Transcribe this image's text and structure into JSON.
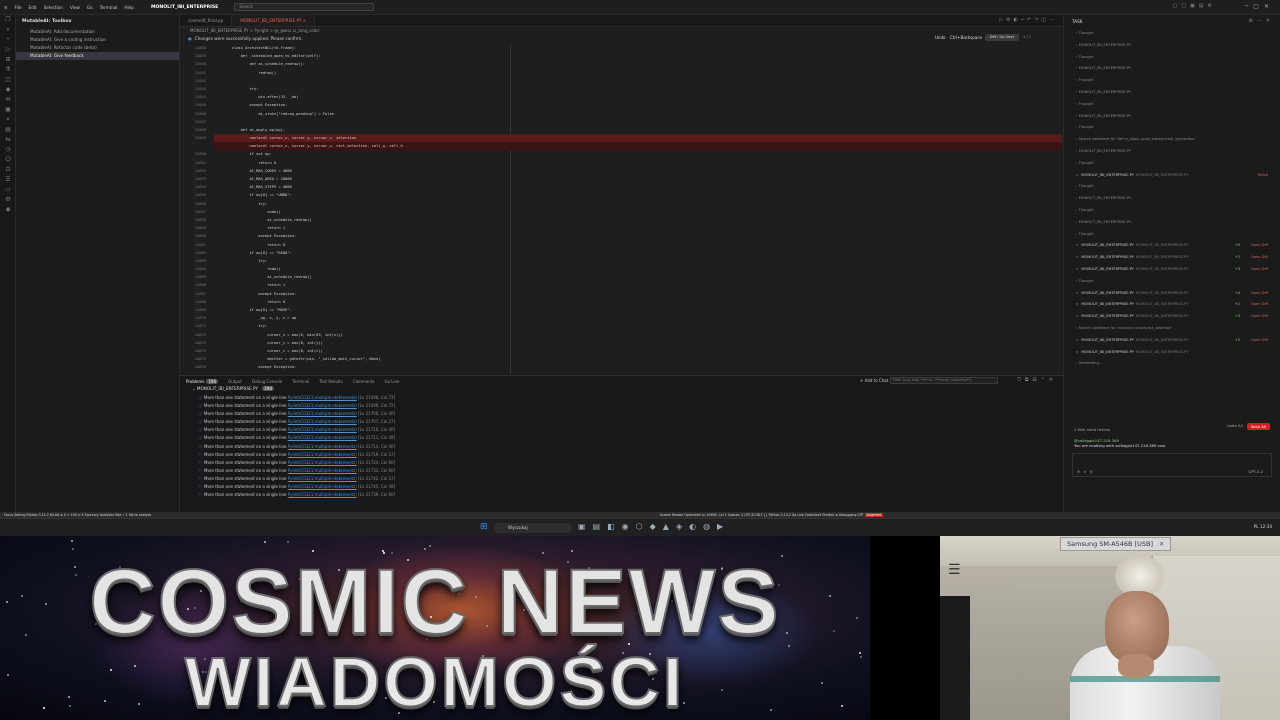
{
  "titlebar": {
    "menus": [
      "File",
      "Edit",
      "Selection",
      "View",
      "Go",
      "Terminal",
      "Help"
    ],
    "title": "MONOLIT_IBI_ENTERPRISE",
    "search_placeholder": "Search"
  },
  "sidebar": {
    "heading": "MutableAI: Toolbox",
    "items": [
      {
        "label": "MutableAI: Add documentation"
      },
      {
        "label": "MutableAI: Give a coding instruction"
      },
      {
        "label": "MutableAI: Refactor code (beta)"
      },
      {
        "label": "MutableAI: Give feedback"
      }
    ]
  },
  "editor": {
    "tabs": [
      {
        "label": "cosmolit_final.py"
      },
      {
        "label": "MONOLIT_IBI_ENTERPRISE.PY ×"
      }
    ],
    "breadcrumb": "MONOLIT_IBI_ENTERPRISE.PY > Pyright > @_gwiss ui_lang_code:",
    "notice": "Changes were successfully applied. Please confirm.",
    "undo_label": "Undo",
    "kb_label": "Ctrl+Backspace",
    "pill_label": "Diff / Go Over",
    "pill2_label": "1 / 1",
    "gutter": [
      "14638",
      "14639",
      "14640",
      "14641",
      "14642",
      "14643",
      "14644",
      "14645",
      "14646",
      "14647",
      "14648",
      "14649",
      "",
      "14650",
      "14651",
      "14652",
      "14653",
      "14654",
      "14655",
      "14656",
      "14657",
      "14658",
      "14659",
      "14660",
      "14661",
      "14662",
      "14663",
      "14664",
      "14665",
      "14666",
      "14667",
      "14668",
      "14669",
      "14670",
      "14671",
      "14672",
      "14673",
      "14674",
      "14675",
      "14676",
      "14677",
      "14678"
    ],
    "code": [
      "        class ArchitectBLL(tk.Frame):",
      "            def _scheduled_open_to_editor(self):",
      "                def ai_schedule_redraw():",
      "                    redraw()",
      "",
      "                try:",
      "                    win.after(33, _do)",
      "                except Exception:",
      "                    ai_state[\"redraw_pending\"] = False",
      "",
      "            def ai_apply_op(op):",
      "                nonlocal cursor_x, cursor_y, cursor_c, selection",
      "                nonlocal cursor_x, cursor_y, cursor_c, rect_selection, cell_w, cell_h",
      "                if not op:",
      "                    return 0",
      "                AI_MAX_CODES = 4000",
      "                AI_MAX_AREA = 20000",
      "                AI_MAX_STEPS = 4000",
      "                if op[0] == \"UNDO\":",
      "                    try:",
      "                        undo()",
      "                        ai_schedule_redraw()",
      "                        return 1",
      "                    except Exception:",
      "                        return 0",
      "                if op[0] == \"REDO\":",
      "                    try:",
      "                        redo()",
      "                        ai_schedule_redraw()",
      "                        return 1",
      "                    except Exception:",
      "                        return 0",
      "                if op[0] == \"MOVE\":",
      "                    _op, x, y, c = op",
      "                    try:",
      "                        cursor_x = max(0, min(63, int(x)))",
      "                        cursor_y = max(0, int(y))",
      "                        cursor_c = max(0, int(c))",
      "                        emitter = getattr(win, \"_collab_emit_cursor\", None)",
      "                    except Exception:",
      "                        pass",
      "                    if emitter:"
    ]
  },
  "panel": {
    "tabs": [
      {
        "label": "Problems",
        "badge": "194"
      },
      {
        "label": "Output"
      },
      {
        "label": "Debug Console"
      },
      {
        "label": "Terminal"
      },
      {
        "label": "Test Results"
      },
      {
        "label": "Comments"
      },
      {
        "label": "Go Live"
      }
    ],
    "add_chat": "+ Add to Chat",
    "filter_placeholder": "Filter (e.g. text, **/*.ts, !**/node_modules/**)",
    "file_label": "MONOLIT_IBI_ENTERPRISE.PY",
    "file_badge": "194",
    "problems": [
      {
        "msg": "More than one statement on a single line",
        "src": "Pylint(C0321:multiple-statements)",
        "loc": "[Ln 21098, Col 73]"
      },
      {
        "msg": "More than one statement on a single line",
        "src": "Pylint(C0321:multiple-statements)",
        "loc": "[Ln 21099, Col 72]"
      },
      {
        "msg": "More than one statement on a single line",
        "src": "Pylint(C0321:multiple-statements)",
        "loc": "[Ln 21700, Col 40]"
      },
      {
        "msg": "More than one statement on a single line",
        "src": "Pylint(C0321:multiple-statements)",
        "loc": "[Ln 21707, Col 27]"
      },
      {
        "msg": "More than one statement on a single line",
        "src": "Pylint(C0321:multiple-statements)",
        "loc": "[Ln 21710, Col 40]"
      },
      {
        "msg": "More than one statement on a single line",
        "src": "Pylint(C0321:multiple-statements)",
        "loc": "[Ln 21711, Col 49]"
      },
      {
        "msg": "More than one statement on a single line",
        "src": "Pylint(C0321:multiple-statements)",
        "loc": "[Ln 21714, Col 40]"
      },
      {
        "msg": "More than one statement on a single line",
        "src": "Pylint(C0321:multiple-statements)",
        "loc": "[Ln 21719, Col 37]"
      },
      {
        "msg": "More than one statement on a single line",
        "src": "Pylint(C0321:multiple-statements)",
        "loc": "[Ln 21724, Col 60]"
      },
      {
        "msg": "More than one statement on a single line",
        "src": "Pylint(C0321:multiple-statements)",
        "loc": "[Ln 21733, Col 60]"
      },
      {
        "msg": "More than one statement on a single line",
        "src": "Pylint(C0321:multiple-statements)",
        "loc": "[Ln 21742, Col 37]"
      },
      {
        "msg": "More than one statement on a single line",
        "src": "Pylint(C0321:multiple-statements)",
        "loc": "[Ln 21745, Col 49]"
      },
      {
        "msg": "More than one statement on a single line",
        "src": "Pylint(C0321:multiple-statements)",
        "loc": "[Ln 21739, Col 60]"
      }
    ]
  },
  "chat": {
    "heading": "TASK",
    "rows": [
      {
        "type": "text",
        "label": "Thought"
      },
      {
        "type": "text",
        "label": "MONOLIT_IBI_ENTERPRISE.PY"
      },
      {
        "type": "text",
        "label": "Thought"
      },
      {
        "type": "text",
        "label": "MONOLIT_IBI_ENTERPRISE.PY"
      },
      {
        "type": "text",
        "label": "Thought"
      },
      {
        "type": "text",
        "label": "MONOLIT_IBI_ENTERPRISE.PY"
      },
      {
        "type": "text",
        "label": "Thought"
      },
      {
        "type": "text",
        "label": "MONOLIT_IBI_ENTERPRISE.PY"
      },
      {
        "type": "text",
        "label": "Thought"
      },
      {
        "type": "text",
        "label": "Search codebase for 'def ai_apply_op|ai_state|cursor_x|selection'"
      },
      {
        "type": "text",
        "label": "MONOLIT_IBI_ENTERPRISE.PY"
      },
      {
        "type": "text",
        "label": "Thought"
      },
      {
        "type": "file",
        "label": "MONOLIT_IBI_ENTERPRISE.PY",
        "path": "MONOLIT_IBI_ENTERPRISE.PY",
        "plus": "",
        "status": "Failed"
      },
      {
        "type": "text",
        "label": "Thought"
      },
      {
        "type": "text",
        "label": "MONOLIT_IBI_ENTERPRISE.PY"
      },
      {
        "type": "text",
        "label": "Thought"
      },
      {
        "type": "text",
        "label": "MONOLIT_IBI_ENTERPRISE.PY"
      },
      {
        "type": "text",
        "label": "Thought"
      },
      {
        "type": "file",
        "label": "MONOLIT_IBI_ENTERPRISE.PY",
        "path": "MONOLIT_IBI_ENTERPRISE.PY",
        "plus": "+5",
        "status": "Open Diff"
      },
      {
        "type": "file",
        "label": "MONOLIT_IBI_ENTERPRISE.PY",
        "path": "MONOLIT_IBI_ENTERPRISE.PY",
        "plus": "+2",
        "status": "Open Diff"
      },
      {
        "type": "file",
        "label": "MONOLIT_IBI_ENTERPRISE.PY",
        "path": "MONOLIT_IBI_ENTERPRISE.PY",
        "plus": "+3",
        "status": "Open Diff"
      },
      {
        "type": "text",
        "label": "Thought"
      },
      {
        "type": "file",
        "label": "MONOLIT_IBI_ENTERPRISE.PY",
        "path": "MONOLIT_IBI_ENTERPRISE.PY",
        "plus": "+4",
        "status": "Open Diff"
      },
      {
        "type": "file",
        "label": "MONOLIT_IBI_ENTERPRISE.PY",
        "path": "MONOLIT_IBI_ENTERPRISE.PY",
        "plus": "+2",
        "status": "Open Diff"
      },
      {
        "type": "file",
        "label": "MONOLIT_IBI_ENTERPRISE.PY",
        "path": "MONOLIT_IBI_ENTERPRISE.PY",
        "plus": "+3",
        "status": "Open Diff"
      },
      {
        "type": "text",
        "label": "Search codebase for 'nonlocal cursor|rect_selection'"
      },
      {
        "type": "file",
        "label": "MONOLIT_IBI_ENTERPRISE.PY",
        "path": "MONOLIT_IBI_ENTERPRISE.PY",
        "plus": "+2",
        "status": "Open Diff"
      },
      {
        "type": "file",
        "label": "MONOLIT_IBI_ENTERPRISE.PY",
        "path": "MONOLIT_IBI_ENTERPRISE.PY",
        "plus": "",
        "status": ""
      },
      {
        "type": "text",
        "label": "Generating..."
      }
    ],
    "files_need_review": "1 files need review",
    "undo_all": "Undo All",
    "keep_all": "Keep All",
    "context_tag": "@solleggio147.218.369",
    "context_text": "You are chatting with solleggio147.218.369 now",
    "model": "GPT-5.2"
  },
  "statusbar": {
    "left": "Focus Setting  Python 3.14.2 64-bit  ⊗ 0 ⚠ 194  ⊙ 4  Sourcery Analytics  Kite  ⚡ 1  file to analyze",
    "right": "Screen Reader Optimized  Ln 10658, Col 1  Spaces: 4  UTF-8  CRLF  {} Python  3.14.2  Go Live  CodeGeeX  Prettier  ⊗ Debugging  GPT  ",
    "accent": "Augment"
  },
  "taskbar": {
    "search": "Wyszukaj",
    "tray": "PL  12:34"
  },
  "banner": {
    "line1": "COSMIC NEWS",
    "line2": "WIADOMOŚCI"
  },
  "camera": {
    "device_label": "Samsung SM-A546B [USB]"
  },
  "colors": {
    "accent_red": "#cc2222",
    "diff_red": "#5a1a1a",
    "link_blue": "#4e94ce",
    "ok_green": "#89d185"
  }
}
